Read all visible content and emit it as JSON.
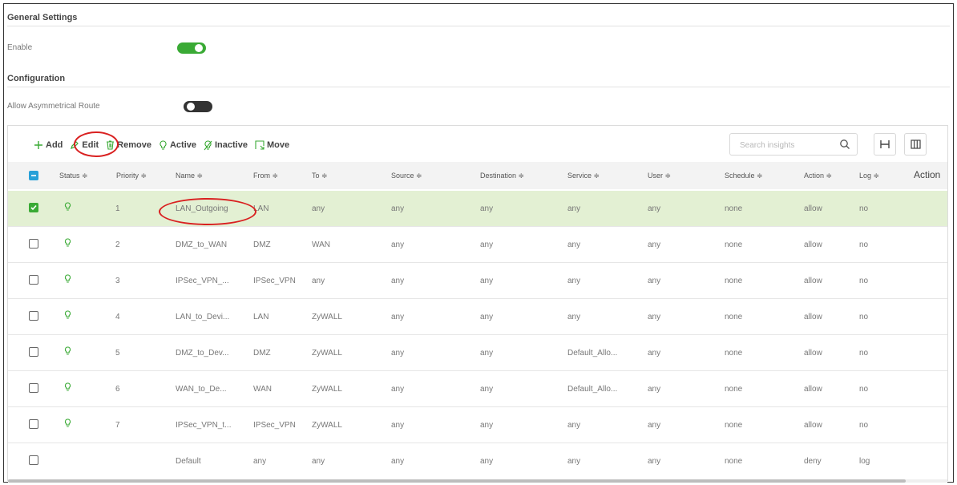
{
  "general": {
    "title": "General Settings",
    "enable_label": "Enable",
    "enable_on": true
  },
  "configuration": {
    "title": "Configuration",
    "asym_label": "Allow Asymmetrical Route",
    "asym_on": false
  },
  "toolbar": {
    "add": "Add",
    "edit": "Edit",
    "remove": "Remove",
    "active": "Active",
    "inactive": "Inactive",
    "move": "Move"
  },
  "search": {
    "placeholder": "Search insights"
  },
  "colors": {
    "accent_green": "#3aaa35",
    "selected_row": "#e3f0d3",
    "annotation_red": "#d92020",
    "header_check": "#27a0d8"
  },
  "table": {
    "headers": [
      "Status ≑",
      "Priority ≑",
      "Name ≑",
      "From ≑",
      "To ≑",
      "Source ≑",
      "Destination ≑",
      "Service ≑",
      "User ≑",
      "Schedule ≑",
      "Action ≑",
      "Log ≑",
      "Action"
    ],
    "rows": [
      {
        "priority": "1",
        "name": "LAN_Outgoing",
        "from": "LAN",
        "to": "any",
        "source": "any",
        "destination": "any",
        "service": "any",
        "user": "any",
        "schedule": "none",
        "action": "allow",
        "log": "no"
      },
      {
        "priority": "2",
        "name": "DMZ_to_WAN",
        "from": "DMZ",
        "to": "WAN",
        "source": "any",
        "destination": "any",
        "service": "any",
        "user": "any",
        "schedule": "none",
        "action": "allow",
        "log": "no"
      },
      {
        "priority": "3",
        "name": "IPSec_VPN_...",
        "from": "IPSec_VPN",
        "to": "any",
        "source": "any",
        "destination": "any",
        "service": "any",
        "user": "any",
        "schedule": "none",
        "action": "allow",
        "log": "no"
      },
      {
        "priority": "4",
        "name": "LAN_to_Devi...",
        "from": "LAN",
        "to": "ZyWALL",
        "source": "any",
        "destination": "any",
        "service": "any",
        "user": "any",
        "schedule": "none",
        "action": "allow",
        "log": "no"
      },
      {
        "priority": "5",
        "name": "DMZ_to_Dev...",
        "from": "DMZ",
        "to": "ZyWALL",
        "source": "any",
        "destination": "any",
        "service": "Default_Allo...",
        "user": "any",
        "schedule": "none",
        "action": "allow",
        "log": "no"
      },
      {
        "priority": "6",
        "name": "WAN_to_De...",
        "from": "WAN",
        "to": "ZyWALL",
        "source": "any",
        "destination": "any",
        "service": "Default_Allo...",
        "user": "any",
        "schedule": "none",
        "action": "allow",
        "log": "no"
      },
      {
        "priority": "7",
        "name": "IPSec_VPN_t...",
        "from": "IPSec_VPN",
        "to": "ZyWALL",
        "source": "any",
        "destination": "any",
        "service": "any",
        "user": "any",
        "schedule": "none",
        "action": "allow",
        "log": "no"
      },
      {
        "priority": "",
        "name": "Default",
        "from": "any",
        "to": "any",
        "source": "any",
        "destination": "any",
        "service": "any",
        "user": "any",
        "schedule": "none",
        "action": "deny",
        "log": "log"
      }
    ]
  }
}
